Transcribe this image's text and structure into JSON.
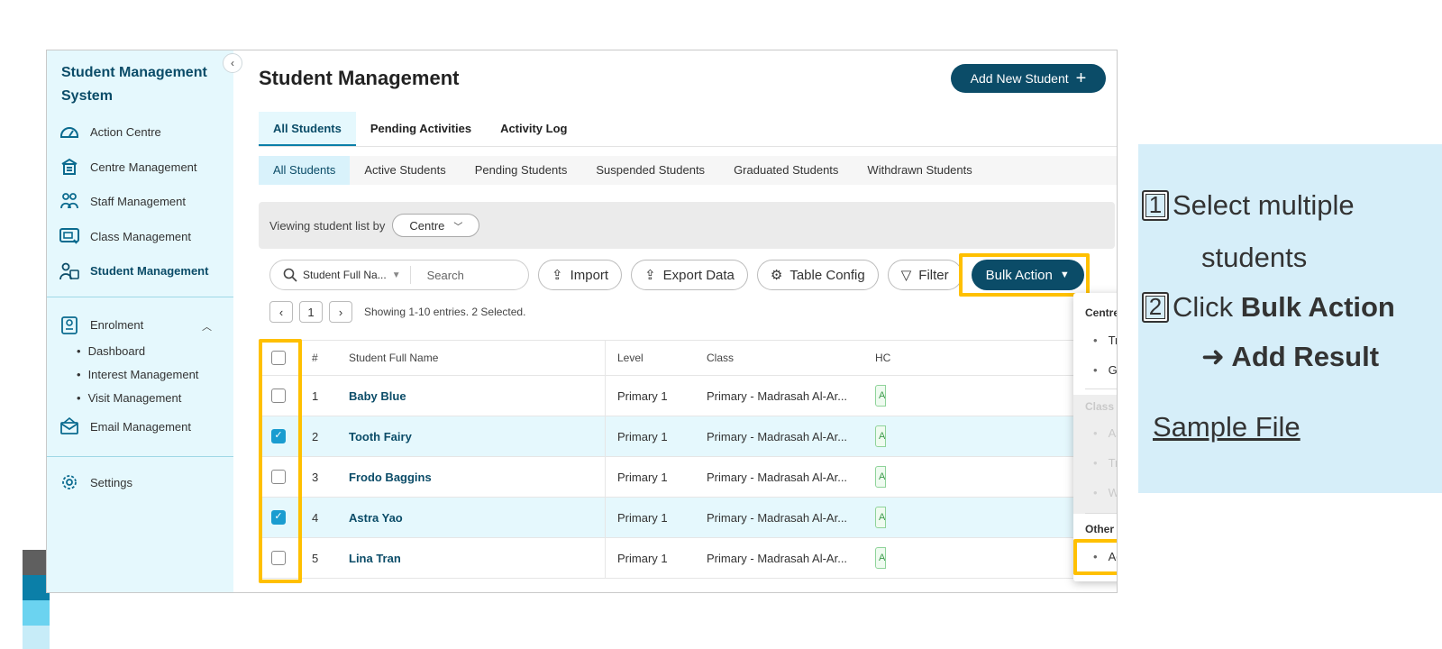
{
  "sidebar": {
    "app_title": "Student Management System",
    "collapse_icon": "chevron-left-icon",
    "items": [
      {
        "label": "Action Centre",
        "icon": "gauge-icon"
      },
      {
        "label": "Centre Management",
        "icon": "building-icon"
      },
      {
        "label": "Staff Management",
        "icon": "staff-group-icon"
      },
      {
        "label": "Class Management",
        "icon": "classroom-icon"
      },
      {
        "label": "Student Management",
        "icon": "students-icon"
      },
      {
        "label": "Enrolment",
        "icon": "enrolment-icon"
      },
      {
        "label": "Email Management",
        "icon": "email-icon"
      },
      {
        "label": "Settings",
        "icon": "gear-icon"
      }
    ],
    "enrolment_sub": [
      "Dashboard",
      "Interest Management",
      "Visit Management"
    ]
  },
  "header": {
    "title": "Student Management",
    "add_button": "Add New Student",
    "add_icon": "+"
  },
  "tabs": [
    "All Students",
    "Pending Activities",
    "Activity Log"
  ],
  "subtabs": [
    "All Students",
    "Active Students",
    "Pending Students",
    "Suspended Students",
    "Graduated Students",
    "Withdrawn Students"
  ],
  "viewbar": {
    "label": "Viewing student list by",
    "value": "Centre"
  },
  "toolbar": {
    "search_field": "Student Full Na...",
    "search_placeholder": "Search",
    "import": "Import",
    "export": "Export Data",
    "table_config": "Table Config",
    "filter": "Filter",
    "bulk_action": "Bulk Action"
  },
  "pager": {
    "page": "1",
    "info": "Showing 1-10 entries. 2 Selected."
  },
  "table": {
    "headers": {
      "num": "#",
      "name": "Student Full Name",
      "level": "Level",
      "class": "Class",
      "hc": "HC"
    },
    "rows": [
      {
        "num": "1",
        "name": "Baby Blue",
        "level": "Primary 1",
        "class": "Primary - Madrasah Al-Ar...",
        "tag": "A",
        "selected": false
      },
      {
        "num": "2",
        "name": "Tooth Fairy",
        "level": "Primary 1",
        "class": "Primary - Madrasah Al-Ar...",
        "tag": "A",
        "selected": true
      },
      {
        "num": "3",
        "name": "Frodo Baggins",
        "level": "Primary 1",
        "class": "Primary - Madrasah Al-Ar...",
        "tag": "A",
        "selected": false
      },
      {
        "num": "4",
        "name": "Astra Yao",
        "level": "Primary 1",
        "class": "Primary - Madrasah Al-Ar...",
        "tag": "A",
        "selected": true
      },
      {
        "num": "5",
        "name": "Lina Tran",
        "level": "Primary 1",
        "class": "Primary - Madrasah Al-Ar...",
        "tag": "A",
        "selected": false
      }
    ]
  },
  "dropdown": {
    "centre_group": "Centre Level Actions",
    "centre_items": [
      "Transfer To Another Centre",
      "Graduate From Centre"
    ],
    "class_group": "Class Level Actions",
    "class_items": [
      "Assign To Class",
      "Transfer To Another Class",
      "Withdraw From Class"
    ],
    "other_group": "Other Actions",
    "other_items": [
      "Add Result"
    ]
  },
  "instructions": {
    "step1_num": "1",
    "step1_text": "Select multiple",
    "step1_text2": "students",
    "step2_num": "2",
    "step2_text": "Click",
    "step2_bold": "Bulk Action",
    "step2_bold2": "➜ Add Result",
    "sample_link": "Sample File"
  },
  "colors": {
    "brand": "#0b4c68",
    "sidebar_bg": "#e5f8fd",
    "highlight": "#ffc000",
    "note_bg": "#d6eef9"
  }
}
